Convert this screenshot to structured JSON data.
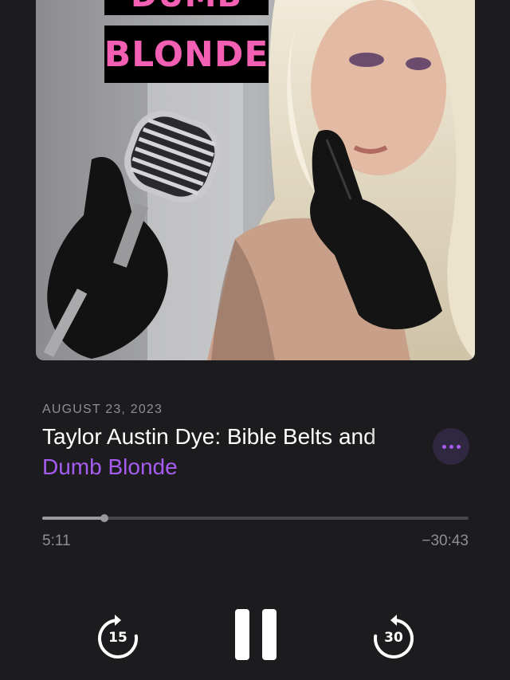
{
  "artwork": {
    "show_title_line1": "DUMB",
    "show_title_line2": "BLONDE"
  },
  "episode": {
    "date": "AUGUST 23, 2023",
    "title": "Taylor Austin Dye: Bible Belts and",
    "show": "Dumb Blonde"
  },
  "playback": {
    "elapsed": "5:11",
    "remaining": "−30:43",
    "progress_fraction": 0.146
  },
  "controls": {
    "skip_back_seconds": "15",
    "skip_forward_seconds": "30",
    "more_icon": "ellipsis-icon",
    "pause_icon": "pause-icon"
  },
  "colors": {
    "accent": "#a65cf0",
    "background": "#1c1c1f",
    "title_pink": "#f25fb3"
  }
}
